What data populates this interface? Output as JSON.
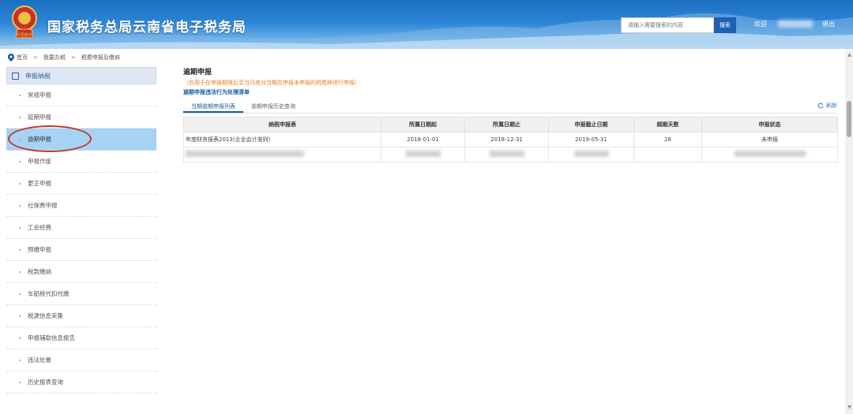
{
  "header": {
    "site_title": "国家税务总局云南省电子税务局",
    "logo_text": "中国税务",
    "search_placeholder": "请输入需要搜索的内容",
    "search_button": "搜索",
    "welcome": "欢迎",
    "logout": "退出"
  },
  "breadcrumb": {
    "items": [
      "首页",
      "我要办税",
      "税费申报及缴纳"
    ],
    "separator": ">"
  },
  "sidebar": {
    "heading": "申报纳税",
    "items": [
      {
        "label": "常规申报"
      },
      {
        "label": "延期申报"
      },
      {
        "label": "逾期申报",
        "active": true
      },
      {
        "label": "申报作废"
      },
      {
        "label": "更正申报"
      },
      {
        "label": "社保费申报"
      },
      {
        "label": "工会经费"
      },
      {
        "label": "预缴申报"
      },
      {
        "label": "税款缴纳"
      },
      {
        "label": "车船税代扣代缴"
      },
      {
        "label": "税源信息采集"
      },
      {
        "label": "申报辅助信息报告"
      },
      {
        "label": "违法处置"
      },
      {
        "label": "历史报表查询"
      }
    ]
  },
  "main": {
    "title": "逾期申报",
    "note": "（仅用于在申报期限后至当月底对当期应申报未申报的税费种进行申报）",
    "violation_link": "逾期申报违法行为处理清单",
    "tabs": [
      {
        "label": "当期逾期申报列表",
        "active": true
      },
      {
        "label": "逾期申报历史查询"
      }
    ],
    "refresh": "刷新",
    "table": {
      "columns": [
        "纳税申报表",
        "所属日期起",
        "所属日期止",
        "申报截止日期",
        "超期天数",
        "申报状态"
      ],
      "rows": [
        [
          "年度财务报表2013(企业会计准则)",
          "2018-01-01",
          "2018-12-31",
          "2019-05-31",
          "28",
          "未申报"
        ]
      ]
    }
  },
  "colors": {
    "header_blue": "#2b84d6",
    "active_item": "#a6d3f3",
    "note_orange": "#e67e22",
    "link_blue": "#1a5aa5",
    "highlight_circle": "#c0392b"
  }
}
